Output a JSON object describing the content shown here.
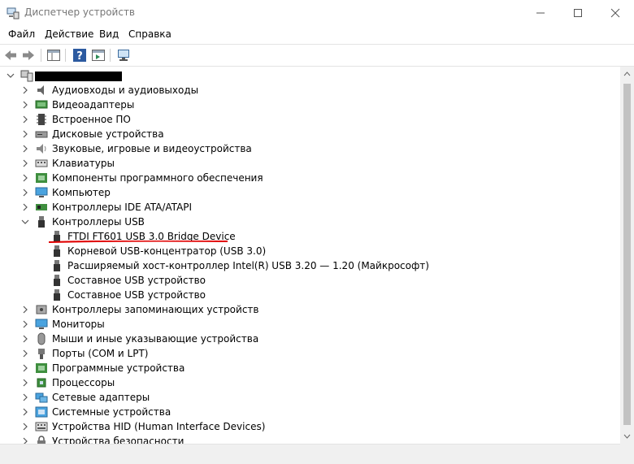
{
  "window": {
    "title": "Диспетчер устройств"
  },
  "menu": [
    "Файл",
    "Действие",
    "Вид",
    "Справка"
  ],
  "tree": {
    "root_label": "",
    "categories": [
      {
        "label": "Аудиовходы и аудиовыходы",
        "icon": "speaker-icon",
        "expanded": false
      },
      {
        "label": "Видеоадаптеры",
        "icon": "display-adapter-icon",
        "expanded": false
      },
      {
        "label": "Встроенное ПО",
        "icon": "firmware-icon",
        "expanded": false
      },
      {
        "label": "Дисковые устройства",
        "icon": "disk-drive-icon",
        "expanded": false
      },
      {
        "label": "Звуковые, игровые и видеоустройства",
        "icon": "sound-icon",
        "expanded": false
      },
      {
        "label": "Клавиатуры",
        "icon": "keyboard-icon",
        "expanded": false
      },
      {
        "label": "Компоненты программного обеспечения",
        "icon": "software-component-icon",
        "expanded": false
      },
      {
        "label": "Компьютер",
        "icon": "computer-icon",
        "expanded": false
      },
      {
        "label": "Контроллеры IDE ATA/ATAPI",
        "icon": "ide-controller-icon",
        "expanded": false
      },
      {
        "label": "Контроллеры USB",
        "icon": "usb-icon",
        "expanded": true
      },
      {
        "label": "Контроллеры запоминающих устройств",
        "icon": "storage-controller-icon",
        "expanded": false
      },
      {
        "label": "Мониторы",
        "icon": "monitor-icon",
        "expanded": false
      },
      {
        "label": "Мыши и иные указывающие устройства",
        "icon": "mouse-icon",
        "expanded": false
      },
      {
        "label": "Порты (COM и LPT)",
        "icon": "port-icon",
        "expanded": false
      },
      {
        "label": "Программные устройства",
        "icon": "software-device-icon",
        "expanded": false
      },
      {
        "label": "Процессоры",
        "icon": "processor-icon",
        "expanded": false
      },
      {
        "label": "Сетевые адаптеры",
        "icon": "network-adapter-icon",
        "expanded": false
      },
      {
        "label": "Системные устройства",
        "icon": "system-device-icon",
        "expanded": false
      },
      {
        "label": "Устройства HID (Human Interface Devices)",
        "icon": "hid-icon",
        "expanded": false
      },
      {
        "label": "Устройства безопасности",
        "icon": "security-device-icon",
        "expanded": false
      }
    ],
    "usb_children": [
      "FTDI FT601 USB 3.0 Bridge Device",
      "Корневой USB-концентратор (USB 3.0)",
      "Расширяемый хост-контроллер Intel(R) USB 3.20 — 1.20 (Майкрософт)",
      "Составное USB устройство",
      "Составное USB устройство"
    ]
  },
  "colors": {
    "highlight_underline": "#e00000",
    "selection": "#cce8ff"
  }
}
